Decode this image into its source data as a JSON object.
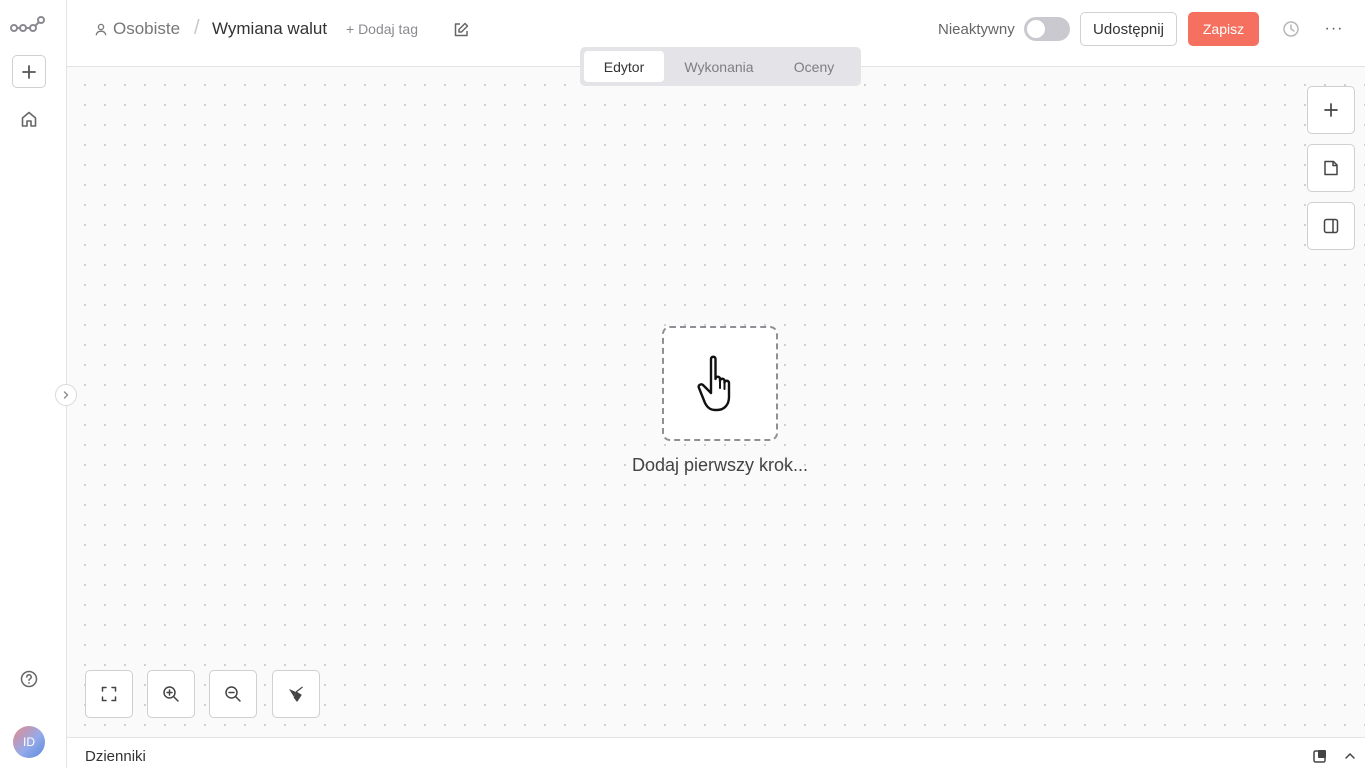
{
  "header": {
    "breadcrumb_project": "Osobiste",
    "breadcrumb_separator": "/",
    "workflow_title": "Wymiana walut",
    "add_tag": "+ Dodaj tag",
    "status_label": "Nieaktywny",
    "active": false,
    "share_label": "Udostępnij",
    "save_label": "Zapisz",
    "more_label": "···"
  },
  "tabs": [
    {
      "label": "Edytor",
      "active": true
    },
    {
      "label": "Wykonania",
      "active": false
    },
    {
      "label": "Oceny",
      "active": false
    }
  ],
  "canvas": {
    "first_step_label": "Dodaj pierwszy krok..."
  },
  "sidebar": {
    "avatar_initials": "ID"
  },
  "footer": {
    "logs_label": "Dzienniki"
  },
  "colors": {
    "accent": "#f5705f",
    "toggle_off": "#c9c9cf"
  },
  "icons": [
    "logo-icon",
    "plus-icon",
    "home-icon",
    "help-icon",
    "chevron-right-icon",
    "user-icon",
    "edit-icon",
    "history-icon",
    "more-icon",
    "sticky-note-icon",
    "panel-icon",
    "fit-view-icon",
    "zoom-in-icon",
    "zoom-out-icon",
    "clean-up-icon",
    "hand-pointer-icon",
    "popout-icon",
    "chevron-up-icon"
  ]
}
